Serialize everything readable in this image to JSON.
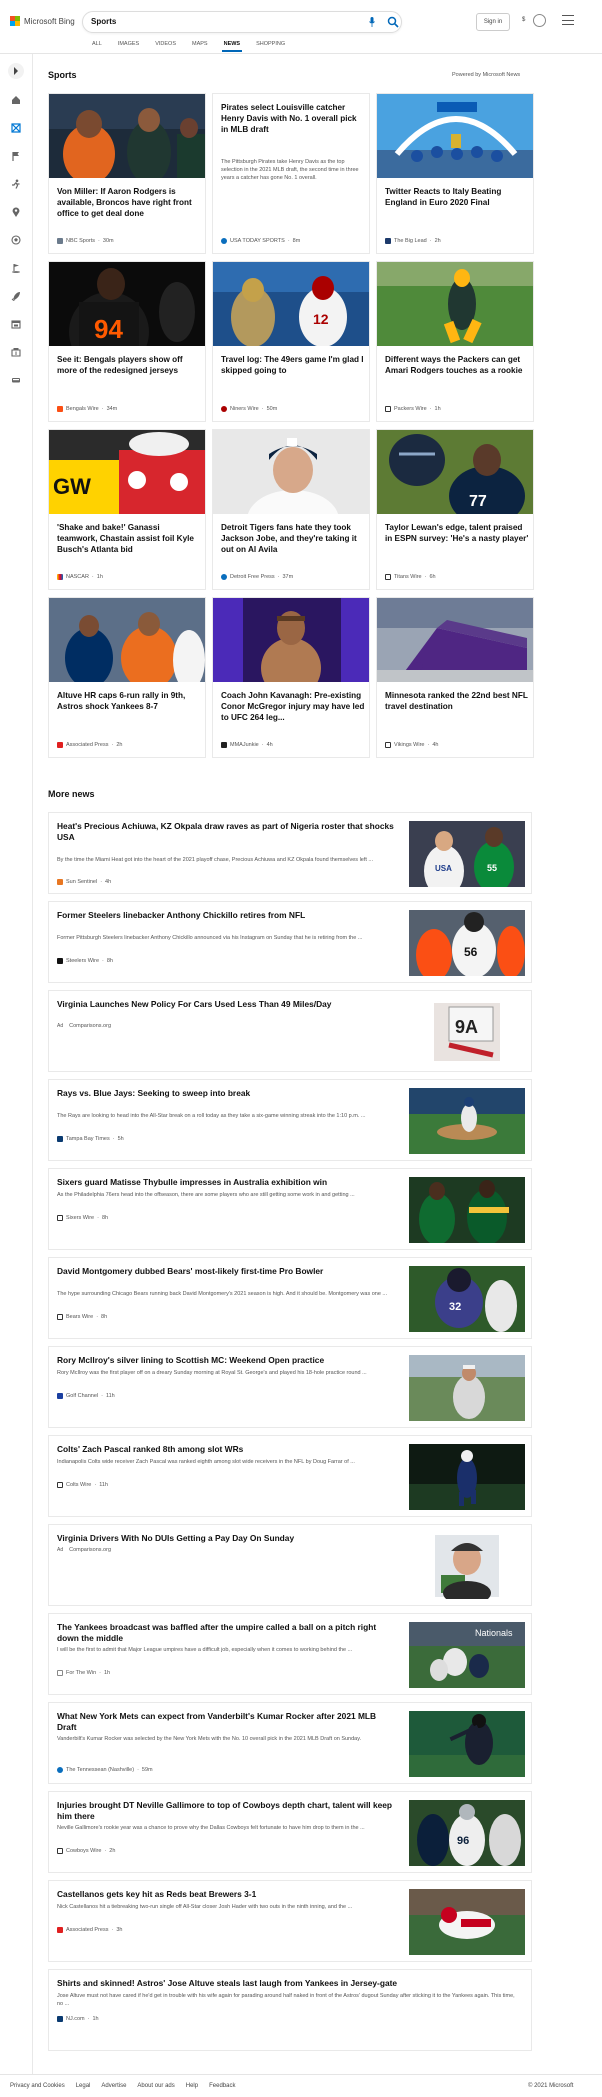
{
  "header": {
    "brand": "Microsoft Bing",
    "search_value": "Sports",
    "signin_label": "Sign in",
    "rewards_count": "$",
    "tabs": [
      "ALL",
      "IMAGES",
      "VIDEOS",
      "MAPS",
      "NEWS",
      "SHOPPING"
    ],
    "active_tab": "NEWS",
    "colors": {
      "accent": "#0067b8"
    }
  },
  "rail": {
    "icons": [
      "expand-arrow-icon",
      "home-icon",
      "puzzle-icon",
      "flag-icon",
      "running-icon",
      "location-pin-icon",
      "soccer-ball-icon",
      "golf-icon",
      "rocket-icon",
      "calendar-icon",
      "stadium-icon",
      "car-icon"
    ]
  },
  "sports": {
    "title": "Sports",
    "powered": "Powered by Microsoft News",
    "cards": [
      {
        "title": "Von Miller: If Aaron Rodgers is available, Broncos have right front office to get deal done",
        "source": "NBC Sports",
        "time": "30m",
        "desc": ""
      },
      {
        "title": "Pirates select Louisville catcher Henry Davis with No. 1 overall pick in MLB draft",
        "source": "USA TODAY SPORTS",
        "time": "8m",
        "desc": "The Pittsburgh Pirates take Henry Davis as the top selection in the 2021 MLB draft, the second time in three years a catcher has gone No. 1 overall."
      },
      {
        "title": "Twitter Reacts to Italy Beating England in Euro 2020 Final",
        "source": "The Big Lead",
        "time": "2h",
        "desc": ""
      },
      {
        "title": "See it: Bengals players show off more of the redesigned jerseys",
        "source": "Bengals Wire",
        "time": "34m",
        "desc": ""
      },
      {
        "title": "Travel log: The 49ers game I'm glad I skipped going to",
        "source": "Niners Wire",
        "time": "50m",
        "desc": ""
      },
      {
        "title": "Different ways the Packers can get Amari Rodgers touches as a rookie",
        "source": "Packers Wire",
        "time": "1h",
        "desc": ""
      },
      {
        "title": "'Shake and bake!' Ganassi teamwork, Chastain assist foil Kyle Busch's Atlanta bid",
        "source": "NASCAR",
        "time": "1h",
        "desc": ""
      },
      {
        "title": "Detroit Tigers fans hate they took Jackson Jobe, and they're taking it out on Al Avila",
        "source": "Detroit Free Press",
        "time": "37m",
        "desc": ""
      },
      {
        "title": "Taylor Lewan's edge, talent praised in ESPN survey: 'He's a nasty player'",
        "source": "Titans Wire",
        "time": "6h",
        "desc": ""
      },
      {
        "title": "Altuve HR caps 6-run rally in 9th, Astros shock Yankees 8-7",
        "source": "Associated Press",
        "time": "2h",
        "desc": ""
      },
      {
        "title": "Coach John Kavanagh: Pre-existing Conor McGregor injury may have led to UFC 264 leg...",
        "source": "MMAJunkie",
        "time": "4h",
        "desc": ""
      },
      {
        "title": "Minnesota ranked the 22nd best NFL travel destination",
        "source": "Vikings Wire",
        "time": "4h",
        "desc": ""
      }
    ]
  },
  "more_news": {
    "title": "More news",
    "items": [
      {
        "title": "Heat's Precious Achiuwa, KZ Okpala draw raves as part of Nigeria roster that shocks USA",
        "desc": "By the time the Miami Heat got into the heart of the 2021 playoff chase, Precious Achiuwa and KZ Okpala found themselves left ...",
        "source": "Sun Sentinel",
        "time": "4h",
        "ad": false
      },
      {
        "title": "Former Steelers linebacker Anthony Chickillo retires from NFL",
        "desc": "Former Pittsburgh Steelers linebacker Anthony Chickillo announced via his Instagram on Sunday that he is retiring from the ...",
        "source": "Steelers Wire",
        "time": "8h",
        "ad": false
      },
      {
        "title": "Virginia Launches New Policy For Cars Used Less Than 49 Miles/Day",
        "desc": "",
        "source": "Comparisons.org",
        "time": "",
        "ad": true,
        "ad_label": "Ad"
      },
      {
        "title": "Rays vs. Blue Jays: Seeking to sweep into break",
        "desc": "The Rays are looking to head into the All-Star break on a roll today as they take a six-game winning streak into the 1:10 p.m. ...",
        "source": "Tampa Bay Times",
        "time": "5h",
        "ad": false
      },
      {
        "title": "Sixers guard Matisse Thybulle impresses in Australia exhibition win",
        "desc": "As the Philadelphia 76ers head into the offseason, there are some players who are still getting some work in and getting ...",
        "source": "Sixers Wire",
        "time": "8h",
        "ad": false
      },
      {
        "title": "David Montgomery dubbed Bears' most-likely first-time Pro Bowler",
        "desc": "The hype surrounding Chicago Bears running back David Montgomery's 2021 season is high. And it should be. Montgomery was one ...",
        "source": "Bears Wire",
        "time": "8h",
        "ad": false
      },
      {
        "title": "Rory McIlroy's silver lining to Scottish MC: Weekend Open practice",
        "desc": "Rory McIlroy was the first player off on a dreary Sunday morning at Royal St. George's and played his 18-hole practice round ...",
        "source": "Golf Channel",
        "time": "11h",
        "ad": false
      },
      {
        "title": "Colts' Zach Pascal ranked 8th among slot WRs",
        "desc": "Indianapolis Colts wide receiver Zach Pascal was ranked eighth among slot wide receivers in the NFL by Doug Farrar of ...",
        "source": "Colts Wire",
        "time": "11h",
        "ad": false
      },
      {
        "title": "Virginia Drivers With No DUIs Getting a Pay Day On Sunday",
        "desc": "",
        "source": "Comparisons.org",
        "time": "",
        "ad": true,
        "ad_label": "Ad"
      },
      {
        "title": "The Yankees broadcast was baffled after the umpire called a ball on a pitch right down the middle",
        "desc": "I will be the first to admit that Major League umpires have a difficult job, especially when it comes to working behind the ...",
        "source": "For The Win",
        "time": "1h",
        "ad": false
      },
      {
        "title": "What New York Mets can expect from Vanderbilt's Kumar Rocker after 2021 MLB Draft",
        "desc": "Vanderbilt's Kumar Rocker was selected by the New York Mets with the No. 10 overall pick in the 2021 MLB Draft on Sunday.",
        "source": "The Tennessean (Nashville)",
        "time": "59m",
        "ad": false
      },
      {
        "title": "Injuries brought DT Neville Gallimore to top of Cowboys depth chart, talent will keep him there",
        "desc": "Neville Gallimore's rookie year was a chance to prove why the Dallas Cowboys felt fortunate to have him drop to them in the ...",
        "source": "Cowboys Wire",
        "time": "2h",
        "ad": false
      },
      {
        "title": "Castellanos gets key hit as Reds beat Brewers 3-1",
        "desc": "Nick Castellanos hit a tiebreaking two-run single off All-Star closer Josh Hader with two outs in the ninth inning, and the ...",
        "source": "Associated Press",
        "time": "3h",
        "ad": false
      },
      {
        "title": "Shirts and skinned! Astros' Jose Altuve steals last laugh from Yankees in Jersey-gate",
        "desc": "Jose Altuve must not have cared if he'd get in trouble with his wife again for parading around half naked in front of the Astros' dugout Sunday after sticking it to the Yankees again. This time, no ...",
        "source": "NJ.com",
        "time": "1h",
        "ad": false
      }
    ]
  },
  "footer": {
    "links": [
      "Privacy and Cookies",
      "Legal",
      "Advertise",
      "About our ads",
      "Help",
      "Feedback"
    ],
    "copyright": "© 2021 Microsoft"
  }
}
